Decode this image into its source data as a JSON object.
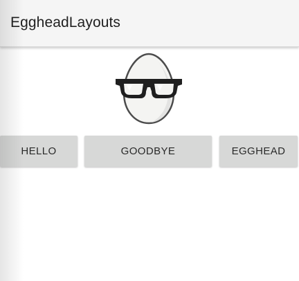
{
  "app_bar": {
    "title": "EggheadLayouts"
  },
  "logo": {
    "icon": "egghead-glasses-icon"
  },
  "buttons": {
    "hello": "HELLO",
    "goodbye": "GOODBYE",
    "egghead": "EGGHEAD"
  },
  "colors": {
    "app_bar_bg": "#f5f5f5",
    "button_bg": "#d7d8d7",
    "text": "#212121"
  }
}
